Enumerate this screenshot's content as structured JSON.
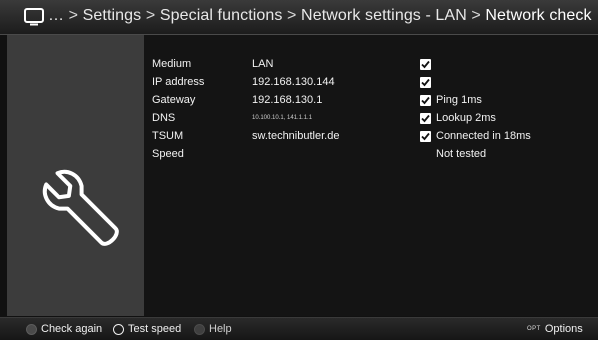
{
  "header": {
    "icon": "tv-icon",
    "ellipsis": "…",
    "separator": ">",
    "crumbs": [
      "Settings",
      "Special functions",
      "Network settings - LAN"
    ],
    "current": "Network check"
  },
  "sidebar": {
    "icon": "wrench-icon"
  },
  "network_check": {
    "rows": [
      {
        "label": "Medium",
        "value": "LAN",
        "checked": true,
        "status": ""
      },
      {
        "label": "IP address",
        "value": "192.168.130.144",
        "checked": true,
        "status": ""
      },
      {
        "label": "Gateway",
        "value": "192.168.130.1",
        "checked": true,
        "status": "Ping 1ms"
      },
      {
        "label": "DNS",
        "value": "10.100.10.1, 141.1.1.1",
        "checked": true,
        "status": "Lookup 2ms"
      },
      {
        "label": "TSUM",
        "value": "sw.technibutler.de",
        "checked": true,
        "status": "Connected in 18ms"
      },
      {
        "label": "Speed",
        "value": "",
        "checked": false,
        "status": "Not tested"
      }
    ]
  },
  "footer": {
    "check_again_label": "Check again",
    "test_speed_label": "Test speed",
    "help_label": "Help",
    "opt_tag": "OPT",
    "options_label": "Options"
  }
}
